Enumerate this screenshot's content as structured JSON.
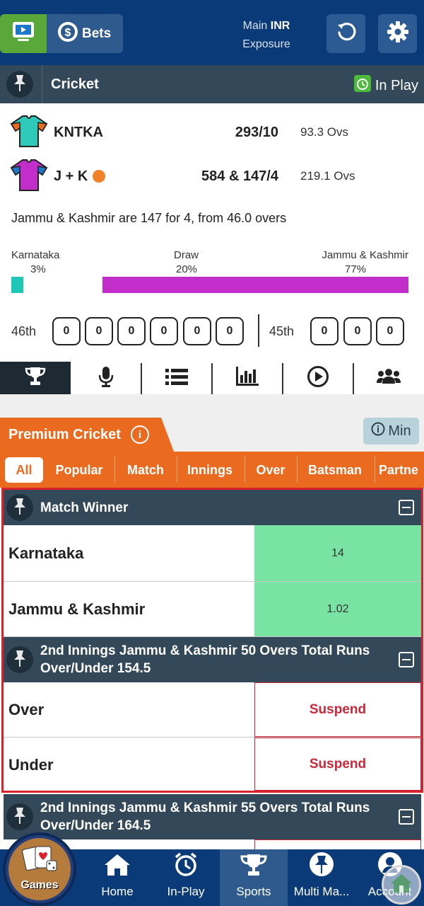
{
  "topbar": {
    "bets_label": "Bets",
    "main_label": "Main",
    "currency": "INR",
    "exposure_label": "Exposure"
  },
  "sport_bar": {
    "title": "Cricket",
    "inplay_label": "In Play"
  },
  "score": {
    "team1": {
      "name": "KNTKA",
      "score": "293/10",
      "overs": "93.3 Ovs",
      "shirt_color": "#2ec9b8"
    },
    "team2": {
      "name": "J + K",
      "score": "584 & 147/4",
      "overs": "219.1 Ovs",
      "shirt_color": "#c22ec9"
    },
    "status": "Jammu & Kashmir are 147 for 4, from 46.0 overs",
    "probability": {
      "team1": {
        "label": "Karnataka",
        "percent_text": "3%",
        "value": 3,
        "color": "#1fc7b6"
      },
      "draw": {
        "label": "Draw",
        "percent_text": "20%",
        "value": 20,
        "color": "#ffffff"
      },
      "team2": {
        "label": "Jammu & Kashmir",
        "percent_text": "77%",
        "value": 77,
        "color": "#c22ec9"
      }
    },
    "current_over": {
      "label": "46th",
      "balls": [
        "0",
        "0",
        "0",
        "0",
        "0",
        "0"
      ]
    },
    "previous_over": {
      "label": "45th",
      "balls": [
        "0",
        "0",
        "0"
      ]
    }
  },
  "icon_nav": [
    "trophy-icon",
    "microphone-icon",
    "list-icon",
    "bar-chart-icon",
    "play-icon",
    "users-icon"
  ],
  "premium": {
    "title": "Premium Cricket",
    "min_label": "Min"
  },
  "filters": [
    "All",
    "Popular",
    "Match",
    "Innings",
    "Over",
    "Batsman",
    "Partne"
  ],
  "markets": [
    {
      "title": "Match Winner",
      "runners": [
        {
          "name": "Karnataka",
          "odds": "14"
        },
        {
          "name": "Jammu & Kashmir",
          "odds": "1.02"
        }
      ]
    },
    {
      "title": "2nd Innings Jammu & Kashmir 50 Overs Total Runs Over/Under 154.5",
      "runners": [
        {
          "name": "Over",
          "odds": "Suspend"
        },
        {
          "name": "Under",
          "odds": "Suspend"
        }
      ]
    },
    {
      "title": "2nd Innings Jammu & Kashmir 55 Overs Total Runs Over/Under 164.5"
    }
  ],
  "bottom_nav": {
    "games": "Games",
    "home": "Home",
    "inplay": "In-Play",
    "sports": "Sports",
    "multi": "Multi Ma...",
    "account": "Account"
  }
}
